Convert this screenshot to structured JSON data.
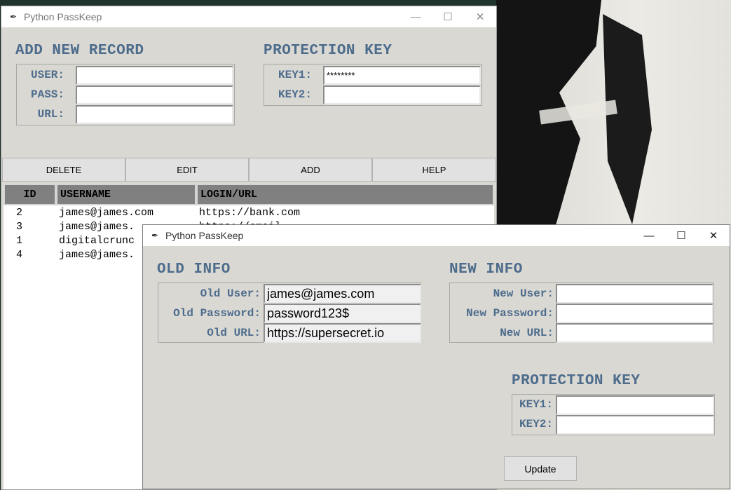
{
  "main_window": {
    "title": "Python PassKeep",
    "add_section": {
      "heading": "ADD NEW RECORD",
      "user_label": "USER:",
      "pass_label": "PASS:",
      "url_label": "URL:",
      "user_value": "",
      "pass_value": "",
      "url_value": ""
    },
    "key_section": {
      "heading": "PROTECTION KEY",
      "key1_label": "KEY1:",
      "key2_label": "KEY2:",
      "key1_value": "********",
      "key2_value": ""
    },
    "toolbar": {
      "delete": "DELETE",
      "edit": "EDIT",
      "add": "ADD",
      "help": "HELP"
    },
    "table": {
      "columns": [
        "ID",
        "USERNAME",
        "LOGIN/URL"
      ],
      "rows": [
        {
          "id": "2",
          "username": "james@james.com",
          "url": "https://bank.com"
        },
        {
          "id": "3",
          "username": "james@james.",
          "url": "https://email..."
        },
        {
          "id": "1",
          "username": "digitalcrunc",
          "url": ""
        },
        {
          "id": "4",
          "username": "james@james.",
          "url": ""
        }
      ]
    }
  },
  "edit_window": {
    "title": "Python PassKeep",
    "old_info": {
      "heading": "OLD INFO",
      "user_label": "Old User:",
      "password_label": "Old Password:",
      "url_label": "Old URL:",
      "user_value": "james@james.com",
      "password_value": "password123$",
      "url_value": "https://supersecret.io"
    },
    "new_info": {
      "heading": "NEW INFO",
      "user_label": "New User:",
      "password_label": "New Password:",
      "url_label": "New URL:"
    },
    "key_section": {
      "heading": "PROTECTION KEY",
      "key1_label": "KEY1:",
      "key2_label": "KEY2:"
    },
    "update_label": "Update"
  },
  "colors": {
    "label_blue": "#4d6c8c",
    "window_bg": "#d9d8d3",
    "header_gray": "#808080"
  }
}
